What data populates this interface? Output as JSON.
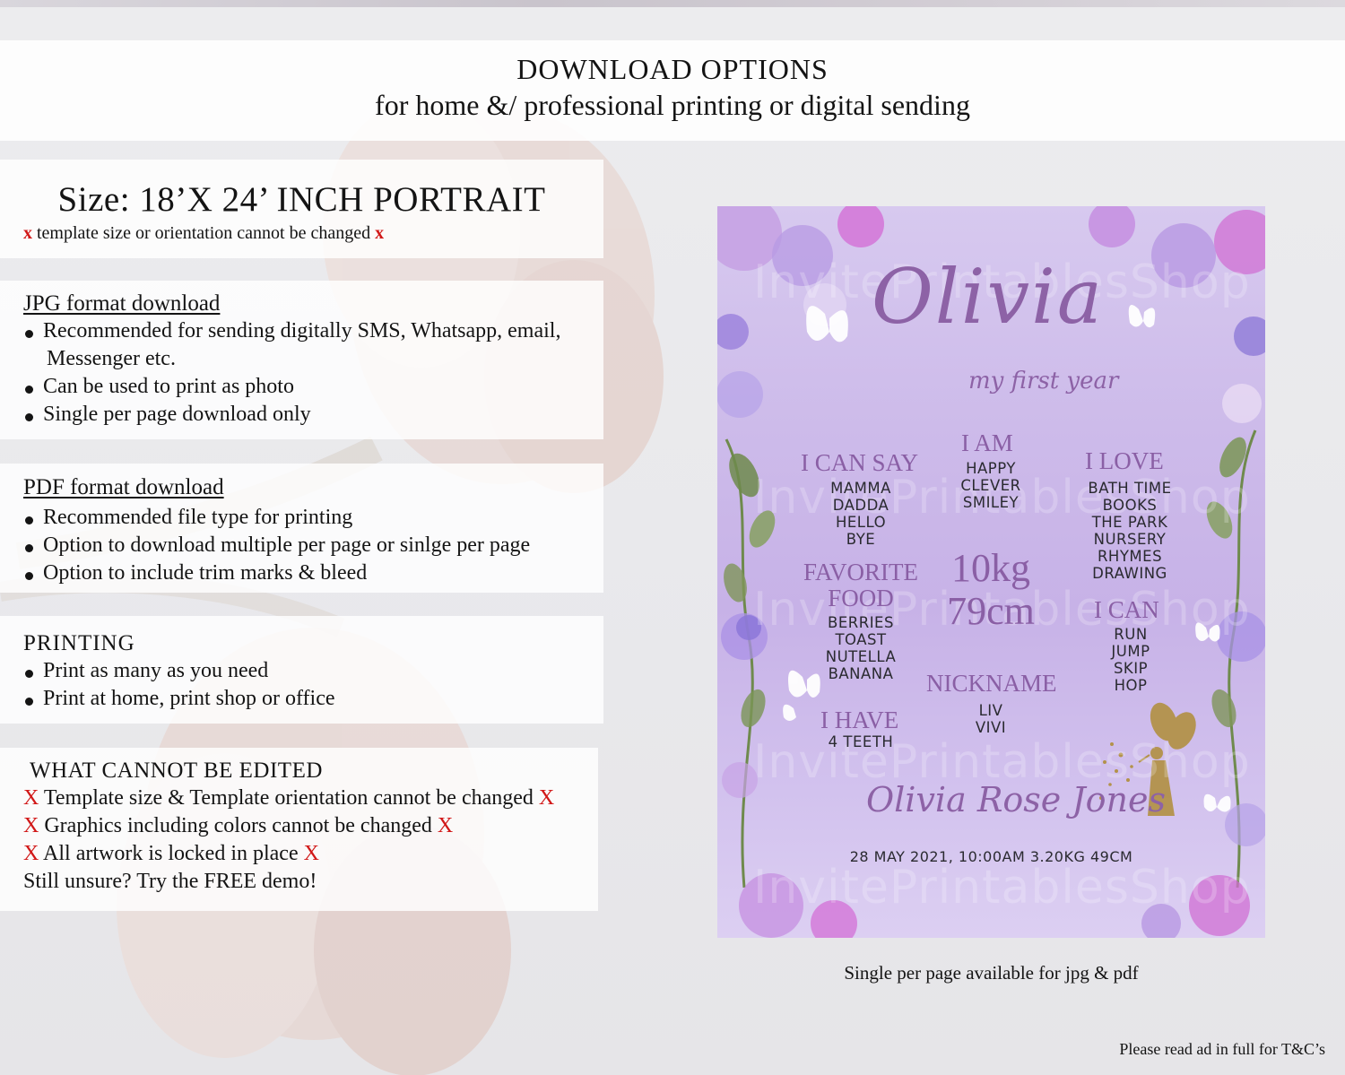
{
  "header": {
    "title": "DOWNLOAD OPTIONS",
    "subtitle": "for home &/ professional printing or digital sending"
  },
  "size_panel": {
    "title": "Size: 18’X 24’ INCH PORTRAIT",
    "x_mark": "x",
    "note": "template size or orientation cannot be changed"
  },
  "jpg_panel": {
    "heading": "JPG format download",
    "items": [
      "Recommended for sending digitally SMS, Whatsapp, email,",
      "Can be used to print as photo",
      "Single per page download only"
    ],
    "item0_continuation": "Messenger etc."
  },
  "pdf_panel": {
    "heading": "PDF format download",
    "items": [
      "Recommended file type for printing",
      "Option to download multiple per page or sinlge per page",
      "Option to include trim marks & bleed"
    ]
  },
  "printing_panel": {
    "heading": "PRINTING",
    "items": [
      "Print as many as you need",
      "Print at home, print shop or office"
    ]
  },
  "cannot_panel": {
    "heading": "WHAT CANNOT BE EDITED",
    "x_mark": "X",
    "lines": [
      "Template size & Template orientation cannot be changed",
      "Graphics including colors cannot be changed",
      "All artwork is locked in place"
    ],
    "demo": "Still unsure? Try the FREE demo!"
  },
  "preview": {
    "watermark": "InvitePrintablesShop",
    "name": "Olivia",
    "subtitle": "my first year",
    "i_can_say": {
      "heading": "I CAN SAY",
      "items": [
        "MAMMA",
        "DADDA",
        "HELLO",
        "BYE"
      ]
    },
    "i_am": {
      "heading": "I AM",
      "items": [
        "HAPPY",
        "CLEVER",
        "SMILEY"
      ]
    },
    "i_love": {
      "heading": "I LOVE",
      "items": [
        "BATH TIME",
        "BOOKS",
        "THE PARK",
        "NURSERY",
        "RHYMES",
        "DRAWING"
      ]
    },
    "favorite_food": {
      "heading_line1": "FAVORITE",
      "heading_line2": "FOOD",
      "items": [
        "BERRIES",
        "TOAST",
        "NUTELLA",
        "BANANA"
      ]
    },
    "weight": "10kg",
    "height": "79cm",
    "i_can": {
      "heading": "I CAN",
      "items": [
        "RUN",
        "JUMP",
        "SKIP",
        "HOP"
      ]
    },
    "nickname": {
      "heading": "NICKNAME",
      "items": [
        "LIV",
        "VIVI"
      ]
    },
    "i_have": {
      "heading": "I HAVE",
      "items": [
        "4 TEETH"
      ]
    },
    "full_name": "Olivia Rose Jones",
    "birth_details": "28 MAY 2021, 10:00AM 3.20KG 49CM"
  },
  "caption": "Single per page available for jpg & pdf",
  "footnote": "Please read ad in full for T&C’s",
  "colors": {
    "accent_purple": "#8a5fa5",
    "card_lavender": "#cdbbea",
    "x_red": "#d11717"
  }
}
